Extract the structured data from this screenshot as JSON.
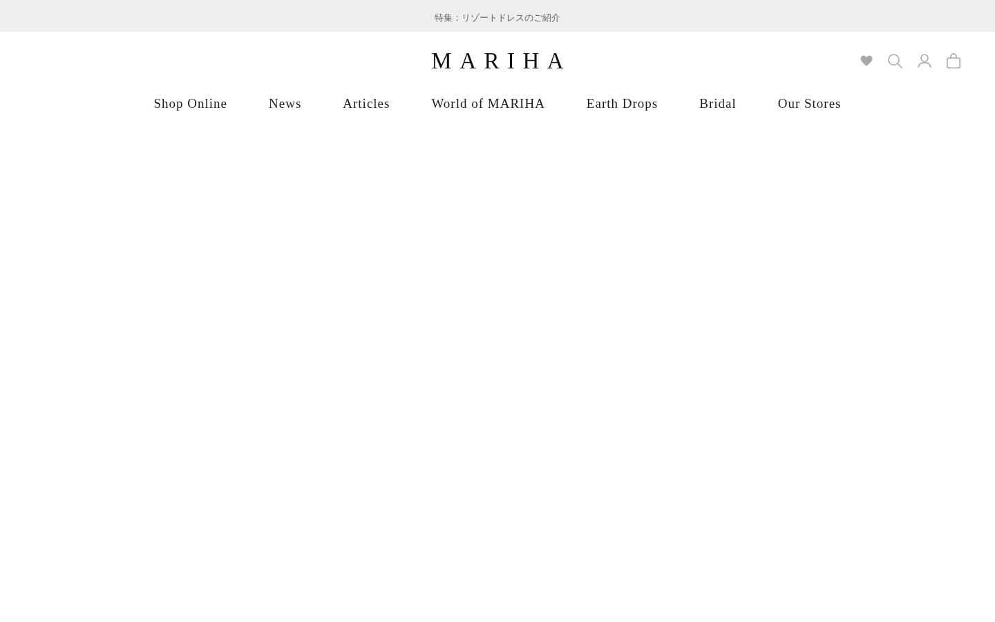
{
  "announcement": {
    "text": "特集：リゾートドレスのご紹介"
  },
  "header": {
    "logo": "MARIHA"
  },
  "nav": {
    "items": [
      {
        "label": "Shop Online"
      },
      {
        "label": "News"
      },
      {
        "label": "Articles"
      },
      {
        "label": "World of MARIHA"
      },
      {
        "label": "Earth Drops"
      },
      {
        "label": "Bridal"
      },
      {
        "label": "Our Stores"
      }
    ]
  }
}
